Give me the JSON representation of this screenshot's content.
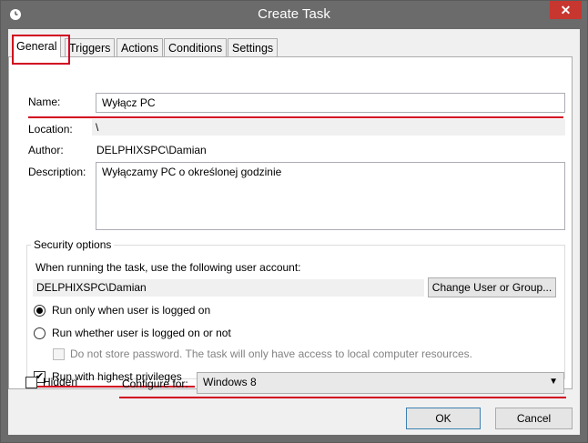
{
  "window": {
    "title": "Create Task",
    "close_glyph": "✕",
    "title_icon": "clock-icon"
  },
  "tabs": [
    {
      "label": "General",
      "active": true
    },
    {
      "label": "Triggers"
    },
    {
      "label": "Actions"
    },
    {
      "label": "Conditions"
    },
    {
      "label": "Settings"
    }
  ],
  "general": {
    "name_label": "Name:",
    "name_value": "Wyłącz PC",
    "location_label": "Location:",
    "location_value": "\\",
    "author_label": "Author:",
    "author_value": "DELPHIXSPC\\Damian",
    "description_label": "Description:",
    "description_value": "Wyłączamy PC o określonej godzinie"
  },
  "security": {
    "group_title": "Security options",
    "account_caption": "When running the task, use the following user account:",
    "account_value": "DELPHIXSPC\\Damian",
    "change_button": "Change User or Group...",
    "radio_logged_on": "Run only when user is logged on",
    "radio_whether": "Run whether user is logged on or not",
    "no_store_password": "Do not store password.  The task will only have access to local computer resources.",
    "highest_privileges": "Run with highest privileges"
  },
  "bottom": {
    "hidden_label": "Hidden",
    "configure_label": "Configure for:",
    "configure_value": "Windows 8",
    "ok_button": "OK",
    "cancel_button": "Cancel"
  },
  "colors": {
    "annotation_red": "#d1001f",
    "titlebar": "#6b6b6b",
    "close": "#c7362f"
  }
}
